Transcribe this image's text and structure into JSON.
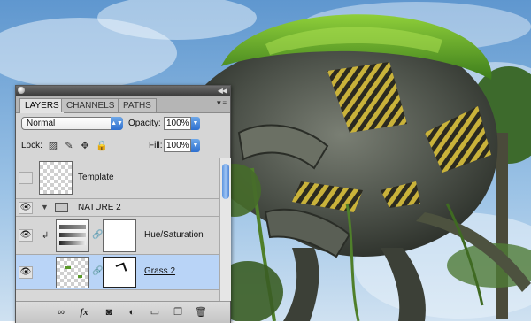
{
  "panel": {
    "tabs": [
      {
        "label": "LAYERS",
        "active": true
      },
      {
        "label": "CHANNELS",
        "active": false
      },
      {
        "label": "PATHS",
        "active": false
      }
    ],
    "blend_mode": "Normal",
    "opacity_label": "Opacity:",
    "opacity_value": "100%",
    "lock_label": "Lock:",
    "fill_label": "Fill:",
    "fill_value": "100%"
  },
  "layers": [
    {
      "name": "Template",
      "visible": false,
      "type": "pixel"
    },
    {
      "name": "NATURE 2",
      "visible": true,
      "type": "group",
      "expanded": true
    },
    {
      "name": "Hue/Saturation",
      "visible": true,
      "type": "adjustment",
      "clipped": true
    },
    {
      "name": "Grass 2",
      "visible": true,
      "type": "pixel-with-mask",
      "selected": true
    }
  ],
  "bottom_bar": {
    "icons": [
      "link-icon",
      "fx-icon",
      "add-mask-icon",
      "adjustment-layer-icon",
      "new-group-icon",
      "new-layer-icon",
      "trash-icon"
    ]
  },
  "colors": {
    "selected_row": "#b9d4f7",
    "accent_blue": "#2d6fcf"
  }
}
